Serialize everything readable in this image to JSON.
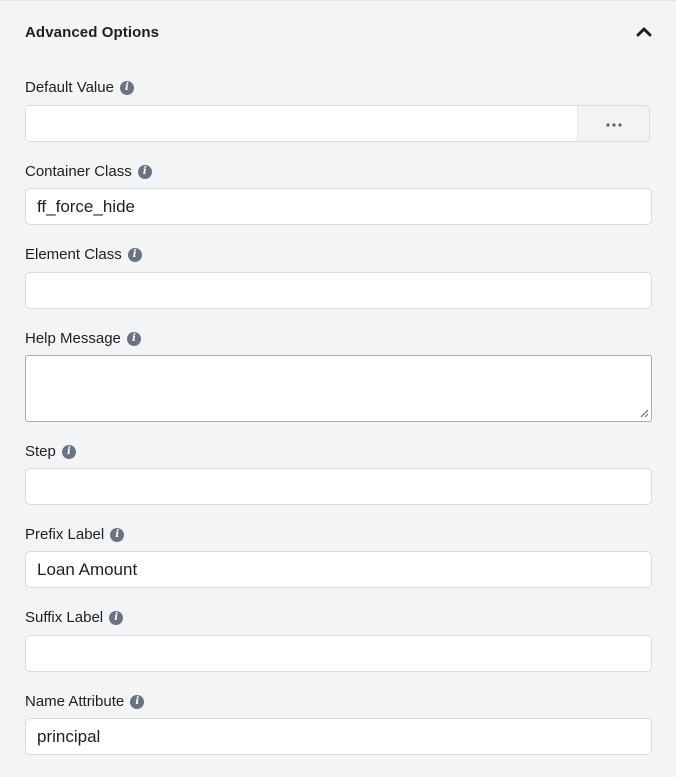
{
  "panel": {
    "title": "Advanced Options",
    "collapse_icon": "chevron-up-icon"
  },
  "fields": {
    "default_value": {
      "label": "Default Value",
      "value": "",
      "append_icon": "more-horizontal-icon"
    },
    "container_class": {
      "label": "Container Class",
      "value": "ff_force_hide"
    },
    "element_class": {
      "label": "Element Class",
      "value": ""
    },
    "help_message": {
      "label": "Help Message",
      "value": ""
    },
    "step": {
      "label": "Step",
      "value": ""
    },
    "prefix_label": {
      "label": "Prefix Label",
      "value": "Loan Amount"
    },
    "suffix_label": {
      "label": "Suffix Label",
      "value": ""
    },
    "name_attribute": {
      "label": "Name Attribute",
      "value": "principal"
    }
  },
  "info_icon": "info-icon"
}
